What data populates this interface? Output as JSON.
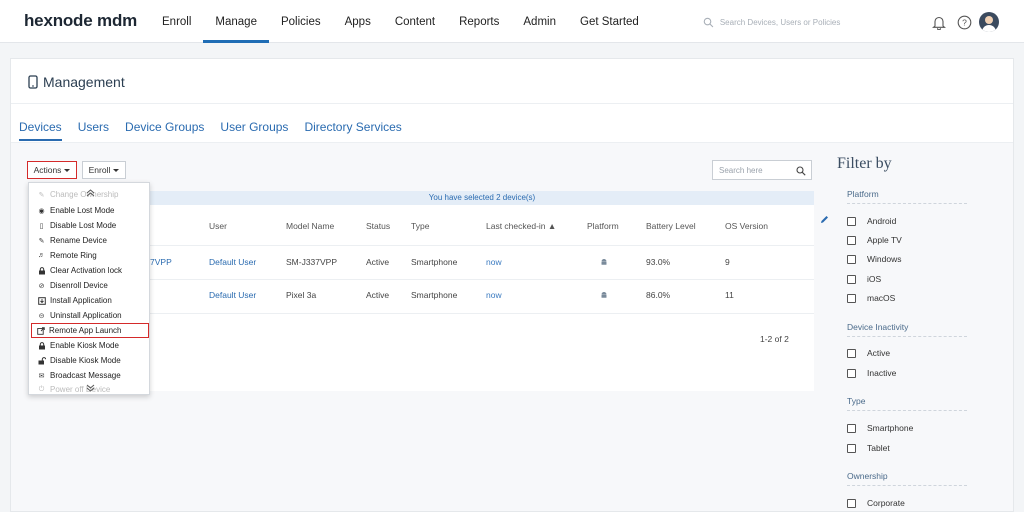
{
  "brand": "hexnode mdm",
  "nav": [
    "Enroll",
    "Manage",
    "Policies",
    "Apps",
    "Content",
    "Reports",
    "Admin",
    "Get Started"
  ],
  "search": {
    "placeholder": "Search Devices, Users or Policies"
  },
  "page_title": "Management",
  "tabs": [
    "Devices",
    "Users",
    "Device Groups",
    "User Groups",
    "Directory Services"
  ],
  "toolbar": {
    "actions_label": "Actions",
    "enroll_label": "Enroll",
    "search_placeholder": "Search here"
  },
  "selection_banner": "You have selected 2 device(s)",
  "table": {
    "headers": [
      "User",
      "Model Name",
      "Status",
      "Type",
      "Last checked-in ▲",
      "Platform",
      "Battery Level",
      "OS Version"
    ],
    "rows": [
      {
        "name_partial": "7VPP",
        "user": "Default User",
        "model": "SM-J337VPP",
        "status": "Active",
        "type": "Smartphone",
        "last_checked": "now",
        "battery": "93.0%",
        "os": "9"
      },
      {
        "name_partial": "",
        "user": "Default User",
        "model": "Pixel 3a",
        "status": "Active",
        "type": "Smartphone",
        "last_checked": "now",
        "battery": "86.0%",
        "os": "11"
      }
    ],
    "pagination": "1-2 of 2"
  },
  "actions_menu": [
    {
      "label": "Change Ownership",
      "icon": "pencil-icon"
    },
    {
      "label": "Enable Lost Mode",
      "icon": "lost-mode-icon"
    },
    {
      "label": "Disable Lost Mode",
      "icon": "phone-icon"
    },
    {
      "label": "Rename Device",
      "icon": "pencil-icon"
    },
    {
      "label": "Remote Ring",
      "icon": "speaker-icon"
    },
    {
      "label": "Clear Activation lock",
      "icon": "lock-icon"
    },
    {
      "label": "Disenroll Device",
      "icon": "disenroll-icon"
    },
    {
      "label": "Install Application",
      "icon": "install-icon"
    },
    {
      "label": "Uninstall Application",
      "icon": "uninstall-icon"
    },
    {
      "label": "Remote App Launch",
      "icon": "app-launch-icon"
    },
    {
      "label": "Enable Kiosk Mode",
      "icon": "lock-icon"
    },
    {
      "label": "Disable Kiosk Mode",
      "icon": "unlock-icon"
    },
    {
      "label": "Broadcast Message",
      "icon": "mail-icon"
    },
    {
      "label": "Power off Device",
      "icon": "power-icon"
    }
  ],
  "filter": {
    "title": "Filter by",
    "sections": [
      {
        "name": "Platform",
        "options": [
          "Android",
          "Apple TV",
          "Windows",
          "iOS",
          "macOS"
        ]
      },
      {
        "name": "Device Inactivity",
        "options": [
          "Active",
          "Inactive"
        ]
      },
      {
        "name": "Type",
        "options": [
          "Smartphone",
          "Tablet"
        ]
      },
      {
        "name": "Ownership",
        "options": [
          "Corporate"
        ]
      }
    ]
  },
  "colors": {
    "accent": "#2a6bb0",
    "highlight": "#d42a2a",
    "nav_active": "#1f6db5"
  }
}
